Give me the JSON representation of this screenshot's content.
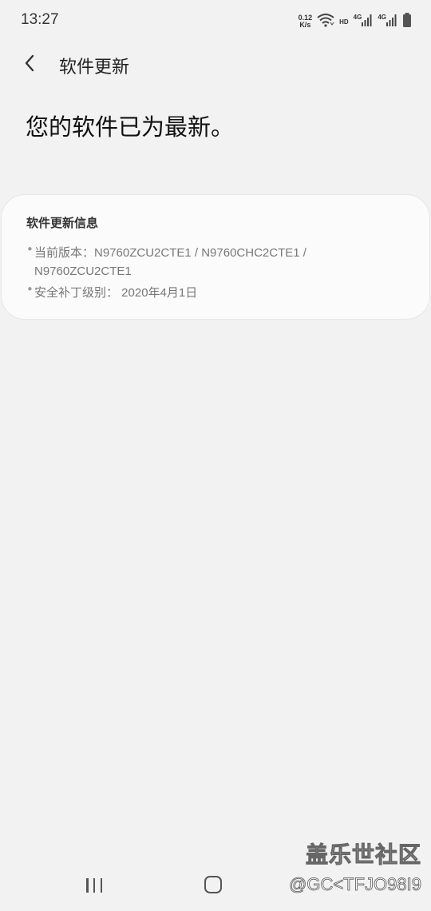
{
  "status_bar": {
    "time": "13:27",
    "net_speed_value": "0.12",
    "net_speed_unit": "K/s",
    "hd_label": "HD",
    "sim1_label": "4G",
    "sim2_label": "4G",
    "icons": [
      "wifi-icon",
      "signal-icon",
      "signal-icon",
      "battery-icon"
    ]
  },
  "header": {
    "title": "软件更新",
    "back_icon": "chevron-left-icon"
  },
  "main": {
    "status_message": "您的软件已为最新。"
  },
  "info_card": {
    "title": "软件更新信息",
    "bullet": "•",
    "version_line_1": "当前版本：N9760ZCU2CTE1 / N9760CHC2CTE1 /",
    "version_line_2": "N9760ZCU2CTE1",
    "security_patch": "安全补丁级别： 2020年4月1日"
  },
  "nav_bar": {
    "icons": [
      "recent-apps-icon",
      "home-icon"
    ]
  },
  "watermark": {
    "site_name": "盖乐世社区",
    "user_handle": "@GC<TFJO98I9"
  }
}
